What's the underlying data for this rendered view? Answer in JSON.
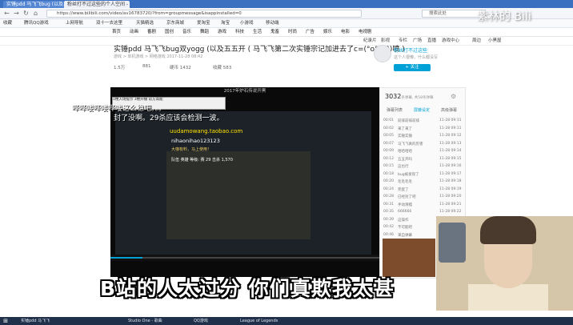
{
  "browser": {
    "tabs": [
      {
        "label": "实锤pdd 马飞飞bug (以及五五开"
      },
      {
        "label": "粉丝打不过这些的个人空间 - 哔哩哔哩"
      }
    ],
    "url": "https://www.bilibili.com/video/av16783720/?from=groupmessage&isappinstalled=0",
    "search_placeholder": "搜索此处"
  },
  "bookmarks": [
    "收藏",
    "腾讯QQ游戏",
    "上网导航",
    "双十一去这里",
    "天猫精选",
    "京东商城",
    "爱淘宝",
    "淘宝",
    "小游戏",
    "移动端"
  ],
  "bili_nav": [
    "首页",
    "动画",
    "番剧",
    "国创",
    "音乐",
    "舞蹈",
    "游戏",
    "科技",
    "生活",
    "鬼畜",
    "时尚",
    "广告",
    "娱乐",
    "电影",
    "电视剧",
    "纪录片",
    "影视",
    "专栏",
    "广场",
    "直播",
    "游戏中心",
    "周边",
    "小黑屋"
  ],
  "video": {
    "title": "实锤pdd 马飞飞bug双yogg (以及五五开 ( 马飞飞第二次实锤宗记加进去了c=(°ο°  *)))喷 )",
    "meta": "游戏 > 单机游戏 > 网络游戏   2017-11-28 08:42",
    "stats": [
      "1.5万",
      "881",
      "硬币 1432",
      "收藏 583"
    ]
  },
  "uploader": {
    "name": "粉丝打不过这些",
    "desc": "这个人很懒，什么都没写",
    "follow_label": "+ 关注"
  },
  "player": {
    "title": "2017年炉石传说开黑",
    "notice": "1楼入场提示 3楼开播 前方高能",
    "danmu": "哔哔喽哔喽哔喽这么稳吧。。。",
    "danmu2": "封了没啊。29杀应该会检测一波。",
    "taobao": "uudamowang.taobao.com",
    "nihao": "nihaonihao123123",
    "gold": "大咖有料，马上使用！",
    "row": "队伍 英雄 等级: 赛 29 击杀 1,570",
    "progress": 0.12
  },
  "danmaku_panel": {
    "count": "3032",
    "count_label": "条弹幕, 共58条弹幕",
    "tabs": [
      "弹幕列表",
      "屏蔽设定",
      "高级弹幕"
    ],
    "rows": [
      {
        "time": "00:01",
        "text": "前排前排前排",
        "date": "11-28 09:11"
      },
      {
        "time": "00:02",
        "text": "来了来了",
        "date": "11-28 09:11"
      },
      {
        "time": "00:05",
        "text": "实锤实锤",
        "date": "11-28 09:12"
      },
      {
        "time": "00:07",
        "text": "马飞飞真的厉害",
        "date": "11-28 09:13"
      },
      {
        "time": "00:09",
        "text": "哈哈哈哈",
        "date": "11-28 09:14"
      },
      {
        "time": "00:12",
        "text": "五五开吗",
        "date": "11-28 09:15"
      },
      {
        "time": "00:15",
        "text": "这也行",
        "date": "11-28 09:16"
      },
      {
        "time": "00:18",
        "text": "bug被发现了",
        "date": "11-28 09:17"
      },
      {
        "time": "00:20",
        "text": "毛毛毛毛",
        "date": "11-28 09:18"
      },
      {
        "time": "00:24",
        "text": "完蛋了",
        "date": "11-28 09:19"
      },
      {
        "time": "00:28",
        "text": "已经封了吧",
        "date": "11-28 09:20"
      },
      {
        "time": "00:31",
        "text": "手动滑稽",
        "date": "11-28 09:21"
      },
      {
        "time": "00:35",
        "text": "666666",
        "date": "11-28 09:22"
      },
      {
        "time": "00:39",
        "text": "这操作",
        "date": "11-28 09:23"
      },
      {
        "time": "00:42",
        "text": "不可能吧",
        "date": "11-28 09:24"
      },
      {
        "time": "00:46",
        "text": "来自弹幕",
        "date": "11-28 09:25"
      },
      {
        "time": "00:50",
        "text": "老铁没毛病",
        "date": "11-28 09:26"
      },
      {
        "time": "00:54",
        "text": "看不下去了",
        "date": "11-28 09:27"
      }
    ]
  },
  "subtitle": "B站的人太过分 你们真欺我太甚",
  "watermark": "紫林的 Bili",
  "taskbar": [
    "实锤pdd 马飞飞",
    "",
    "Studio One - 歌曲",
    "",
    "QQ游戏",
    "",
    "League of Legends",
    ""
  ],
  "colors": {
    "accent": "#00a1d6",
    "tabbar": "#3b6fbf"
  }
}
